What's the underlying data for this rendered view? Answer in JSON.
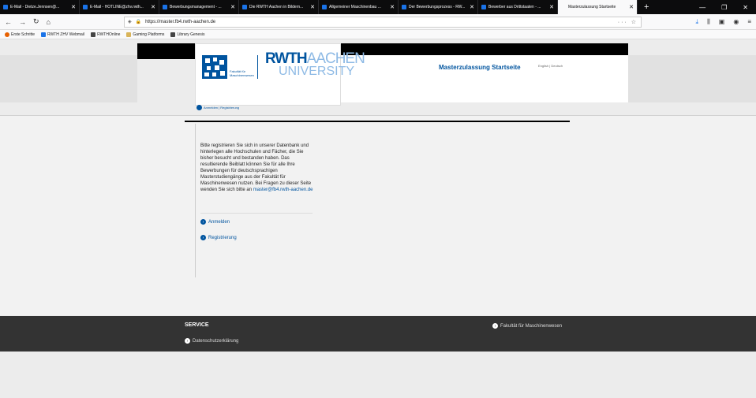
{
  "browser": {
    "tabs": [
      {
        "label": "E-Mail - Dietze.Jennsen@..."
      },
      {
        "label": "E-Mail - HOTLINE@zhv.rwth..."
      },
      {
        "label": "Bewerbungsmanagement - ..."
      },
      {
        "label": "Die RWTH Aachen in Bildern..."
      },
      {
        "label": "Allgemeiner Maschinenbau ..."
      },
      {
        "label": "Der Bewerbungsprozess - RW..."
      },
      {
        "label": "Bewerber aus Drittstaaten - ..."
      },
      {
        "label": "Masterzulassung Startseite"
      }
    ],
    "url": "https://master.fb4.rwth-aachen.de",
    "bookmarks": [
      {
        "label": "Erste Schritte"
      },
      {
        "label": "RWTH ZHV Webmail"
      },
      {
        "label": "RWTHOnline"
      },
      {
        "label": "Gaming Platforms"
      },
      {
        "label": "Library Genesis"
      }
    ]
  },
  "header": {
    "logo_fakultaet": "Fakultät für Maschinenwesen",
    "logo_rwth": "RWTH",
    "logo_aachen": "AACHEN",
    "logo_university": "UNIVERSITY",
    "title": "Masterzulassung Startseite",
    "languages": "English | Deutsch"
  },
  "breadcrumb": "Anmelden | Registrierung",
  "main": {
    "intro_text": "Bitte registrieren Sie sich in unserer Datenbank und hinterlegen alle Hochschulen und Fächer, die Sie bisher besucht und bestanden haben. Das resultierende Beiblatt können Sie für alle Ihre Bewerbungen für deutschsprachigen Masterstudiengänge aus der Fakultät für Maschinenwesen nutzen.",
    "contact_text": "Bei Fragen zu dieser Seite wenden Sie sich bitte an",
    "contact_email": "master@fb4.rwth-aachen.de",
    "login_link": "Anmelden",
    "register_link": "Registrierung"
  },
  "footer": {
    "service_heading": "SERVICE",
    "privacy_link": "Datenschutzerklärung",
    "faculty_link": "Fakultät für Maschinenwesen"
  }
}
